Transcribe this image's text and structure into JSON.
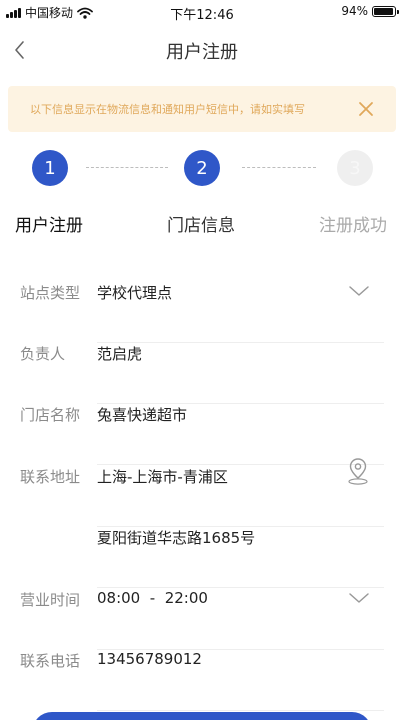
{
  "status_bar": {
    "carrier": "中国移动",
    "time": "下午12:46",
    "battery": "94%",
    "battery_level": 0.94
  },
  "nav": {
    "title": "用户注册"
  },
  "notice": {
    "text": "以下信息显示在物流信息和通知用户短信中，请如实填写",
    "close_label": "X"
  },
  "steps": [
    {
      "number": "1",
      "label": "用户注册"
    },
    {
      "number": "2",
      "label": "门店信息"
    },
    {
      "number": "3",
      "label": "注册成功"
    }
  ],
  "form": {
    "site_type": {
      "label": "站点类型",
      "value": "学校代理点"
    },
    "owner": {
      "label": "负责人",
      "value": "范启虎"
    },
    "store_name": {
      "label": "门店名称",
      "value": "兔喜快递超市"
    },
    "address": {
      "label": "联系地址",
      "region": "上海-上海市-青浦区",
      "detail": "夏阳街道华志路1685号"
    },
    "hours": {
      "label": "营业时间",
      "value": "08:00  -  22:00"
    },
    "phone": {
      "label": "联系电话",
      "value": "13456789012"
    }
  },
  "colors": {
    "primary": "#2f57c8",
    "notice_bg": "#fdf3e2",
    "notice_text": "#e0a85a"
  },
  "icons": [
    "back-icon",
    "close-icon",
    "chevron-down-icon",
    "location-pin-icon",
    "wifi-icon",
    "battery-icon",
    "signal-icon"
  ]
}
